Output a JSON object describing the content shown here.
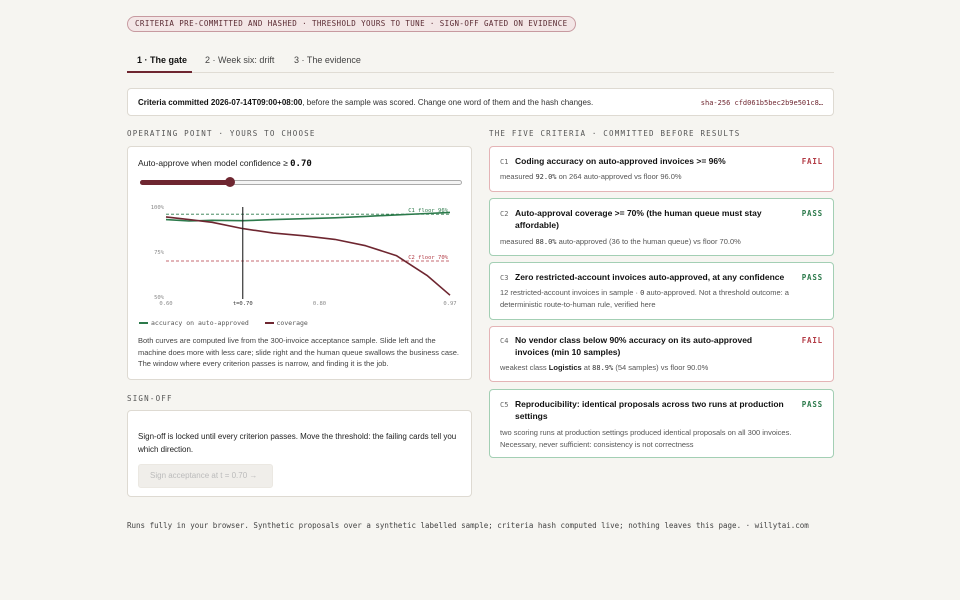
{
  "banner": "CRITERIA PRE-COMMITTED AND HASHED · THRESHOLD YOURS TO TUNE · SIGN-OFF GATED ON EVIDENCE",
  "tabs": [
    {
      "label": "1 · The gate"
    },
    {
      "label": "2 · Week six: drift"
    },
    {
      "label": "3 · The evidence"
    }
  ],
  "commit": {
    "lead": "Criteria committed 2026-07-14T09:00+08:00",
    "rest": ", before the sample was scored. Change one word of them and the hash changes.",
    "hash": "sha-256 cfd061b5bec2b9e501c8…"
  },
  "operating": {
    "section_label": "OPERATING POINT · YOURS TO CHOOSE",
    "question": "Auto-approve when model confidence ≥",
    "value": "0.70",
    "slider_fraction": 0.28,
    "legend_accuracy": "accuracy on auto-approved",
    "legend_coverage": "coverage",
    "description": "Both curves are computed live from the 300-invoice acceptance sample. Slide left and the machine does more with less care; slide right and the human queue swallows the business case. The window where every criterion passes is narrow, and finding it is the job."
  },
  "chart_data": {
    "type": "line",
    "x_ticks": [
      "0.60",
      "0.80",
      "0.97"
    ],
    "y_ticks": [
      "100%",
      "75%",
      "50%"
    ],
    "xlim": [
      0.6,
      0.97
    ],
    "ylim": [
      50,
      100
    ],
    "marker_label": "t=0.70",
    "marker_x": 0.7,
    "reference_lines": [
      {
        "label": "C1 floor 96%",
        "y": 96,
        "color": "#2c7a4b"
      },
      {
        "label": "C2 floor 70%",
        "y": 70,
        "color": "#b23a44"
      }
    ],
    "series": [
      {
        "name": "accuracy on auto-approved",
        "color": "#2c7a4b",
        "x": [
          0.6,
          0.63,
          0.66,
          0.7,
          0.74,
          0.78,
          0.82,
          0.86,
          0.9,
          0.94,
          0.97
        ],
        "y": [
          93.0,
          92.2,
          92.6,
          92.4,
          93.0,
          93.5,
          94.0,
          94.8,
          95.6,
          96.4,
          97.0
        ]
      },
      {
        "name": "coverage",
        "color": "#6e2630",
        "x": [
          0.6,
          0.63,
          0.66,
          0.7,
          0.74,
          0.78,
          0.82,
          0.86,
          0.9,
          0.94,
          0.97
        ],
        "y": [
          94.5,
          93.0,
          91.5,
          88.0,
          85.5,
          84.0,
          82.0,
          78.5,
          73.0,
          62.0,
          51.0
        ]
      }
    ]
  },
  "signoff": {
    "section_label": "SIGN-OFF",
    "text": "Sign-off is locked until every criterion passes. Move the threshold: the failing cards tell you which direction.",
    "button": "Sign acceptance at t = 0.70 →"
  },
  "criteria": {
    "section_label": "THE FIVE CRITERIA · COMMITTED BEFORE RESULTS",
    "items": [
      {
        "id": "C1",
        "title": "Coding accuracy on auto-approved invoices >= 96%",
        "status": "FAIL",
        "d1": "measured ",
        "m": "92.0%",
        "d2": " on 264 auto-approved vs floor 96.0%"
      },
      {
        "id": "C2",
        "title": "Auto-approval coverage >= 70% (the human queue must stay affordable)",
        "status": "PASS",
        "d1": "measured ",
        "m": "88.0%",
        "d2": " auto-approved (36 to the human queue) vs floor 70.0%"
      },
      {
        "id": "C3",
        "title": "Zero restricted-account invoices auto-approved, at any confidence",
        "status": "PASS",
        "d1": "12 restricted-account invoices in sample · ",
        "m": "0",
        "d2": " auto-approved. Not a threshold outcome: a deterministic route-to-human rule, verified here"
      },
      {
        "id": "C4",
        "title": "No vendor class below 90% accuracy on its auto-approved invoices (min 10 samples)",
        "status": "FAIL",
        "d1": "weakest class ",
        "b": "Logistics",
        "d1b": " at ",
        "m": "88.9%",
        "d2": " (54 samples) vs floor 90.0%"
      },
      {
        "id": "C5",
        "title": "Reproducibility: identical proposals across two runs at production settings",
        "status": "PASS",
        "d1": "two scoring runs at production settings produced identical proposals on all 300 invoices. Necessary, never sufficient: consistency is not correctness",
        "m": "",
        "d2": ""
      }
    ]
  },
  "footer": "Runs fully in your browser. Synthetic proposals over a synthetic labelled sample; criteria hash computed live; nothing leaves this page. · willytai.com"
}
